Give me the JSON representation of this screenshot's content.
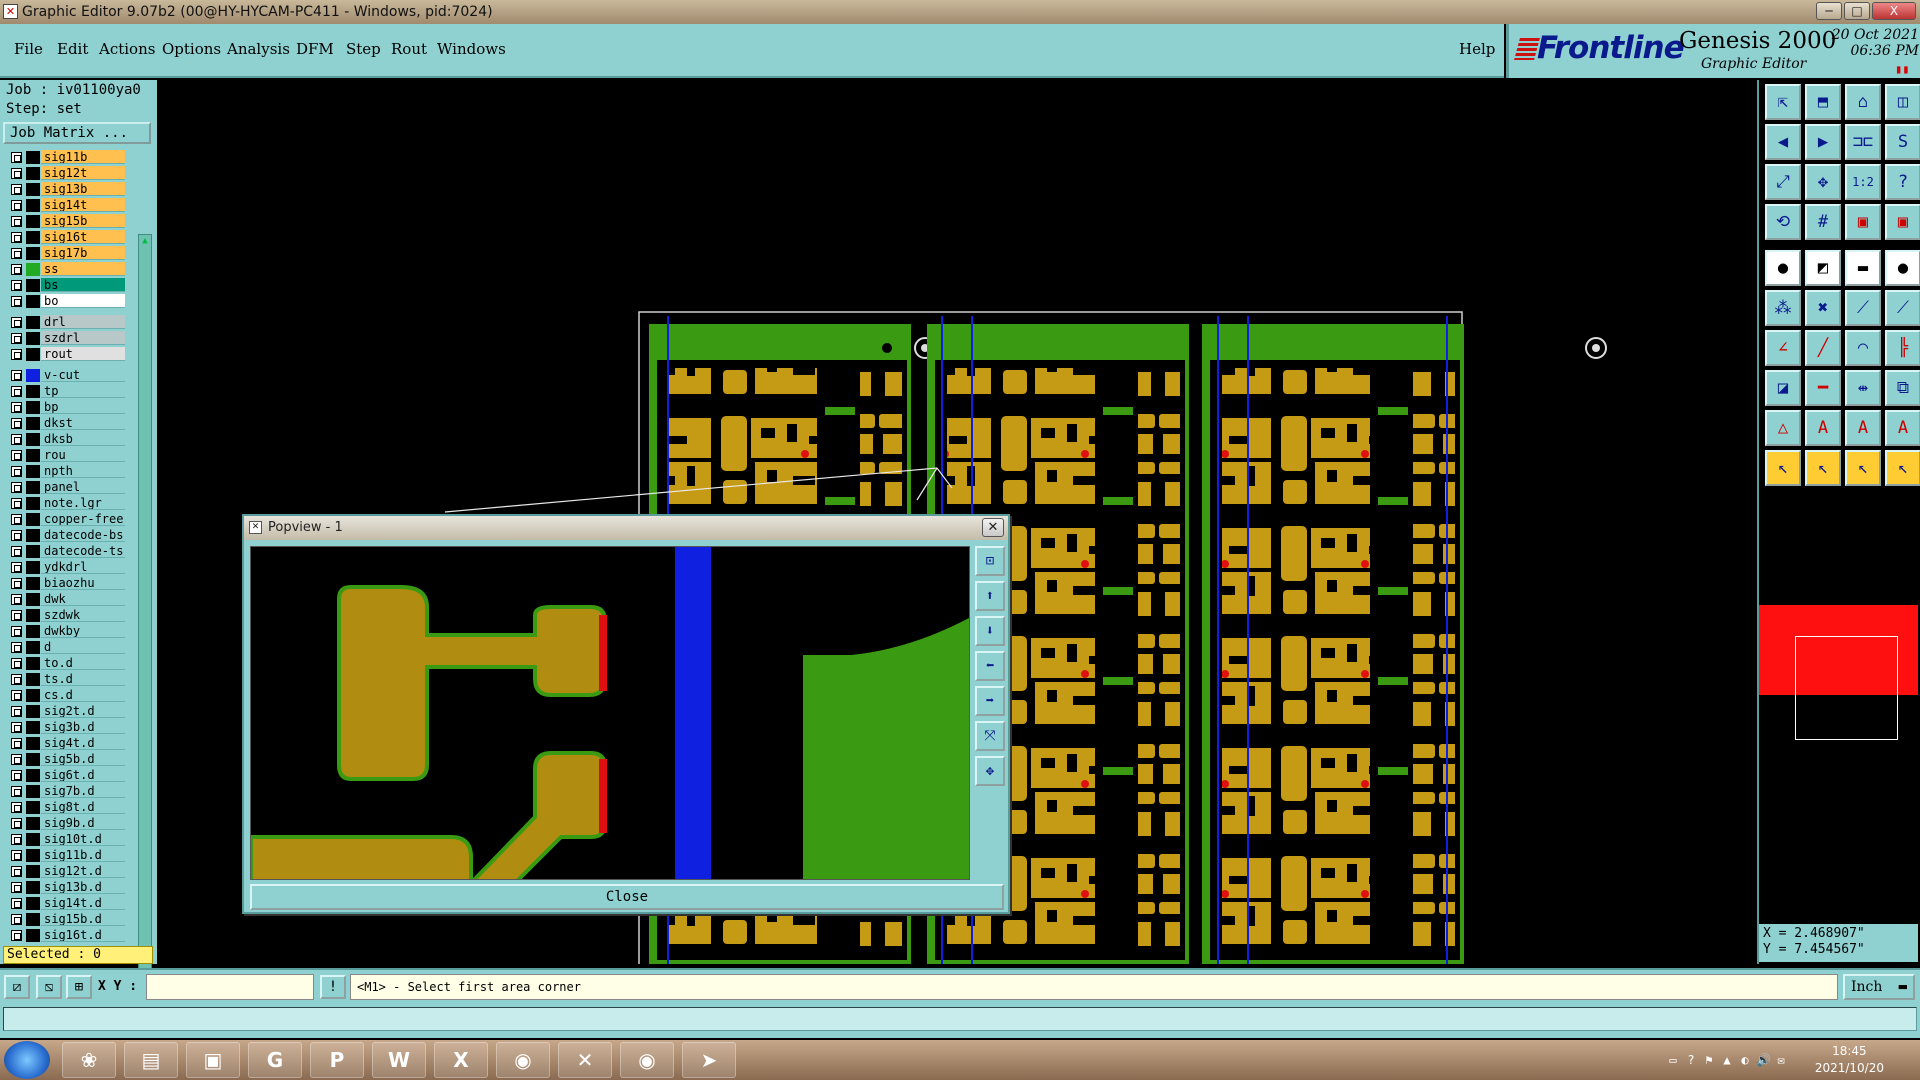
{
  "window": {
    "title": "Graphic Editor 9.07b2 (00@HY-HYCAM-PC411 - Windows, pid:7024)",
    "icon_name": "editor-app-icon",
    "minimize_glyph": "─",
    "maximize_glyph": "□",
    "close_glyph": "X"
  },
  "menubar": {
    "items": [
      "File",
      "Edit",
      "Actions",
      "Options",
      "Analysis",
      "DFM",
      "Step",
      "Rout",
      "Windows"
    ],
    "help": "Help"
  },
  "brand": {
    "logo": "Frontline",
    "product": "Genesis 2000",
    "subtitle": "Graphic Editor",
    "date": "20 Oct 2021",
    "time": "06:36 PM",
    "pause_glyph": "▮▮",
    "logo_color": "#0a1a8c",
    "accent_color": "#cc1111"
  },
  "leftpanel": {
    "job": "Job : iv01100ya0",
    "step": "Step: set",
    "job_matrix": "Job Matrix ...",
    "selected": "Selected : 0",
    "layers": [
      {
        "name": "sig11b",
        "color": "#ffc050",
        "swatch": "#000"
      },
      {
        "name": "sig12t",
        "color": "#ffc050",
        "swatch": "#000"
      },
      {
        "name": "sig13b",
        "color": "#ffc050",
        "swatch": "#000"
      },
      {
        "name": "sig14t",
        "color": "#ffc050",
        "swatch": "#000"
      },
      {
        "name": "sig15b",
        "color": "#ffc050",
        "swatch": "#000"
      },
      {
        "name": "sig16t",
        "color": "#ffc050",
        "swatch": "#000"
      },
      {
        "name": "sig17b",
        "color": "#ffc050",
        "swatch": "#000"
      },
      {
        "name": "ss",
        "color": "#ffc050",
        "swatch": "#22aa22"
      },
      {
        "name": "bs",
        "color": "#009a7a",
        "swatch": "#000"
      },
      {
        "name": "bo",
        "color": "#ffffff",
        "swatch": "#000"
      },
      {
        "name": "drl",
        "color": "#b8c8c8",
        "swatch": "#000",
        "gap": true
      },
      {
        "name": "szdrl",
        "color": "#b8c8c8",
        "swatch": "#000"
      },
      {
        "name": "rout",
        "color": "#e0e0e0",
        "swatch": "#000"
      },
      {
        "name": "v-cut",
        "color": "#8fd1d1",
        "swatch": "#1020e0",
        "gap": true
      },
      {
        "name": "tp",
        "color": "#8fd1d1",
        "swatch": "#000"
      },
      {
        "name": "bp",
        "color": "#8fd1d1",
        "swatch": "#000"
      },
      {
        "name": "dkst",
        "color": "#8fd1d1",
        "swatch": "#000"
      },
      {
        "name": "dksb",
        "color": "#8fd1d1",
        "swatch": "#000"
      },
      {
        "name": "rou",
        "color": "#8fd1d1",
        "swatch": "#000"
      },
      {
        "name": "npth",
        "color": "#8fd1d1",
        "swatch": "#000"
      },
      {
        "name": "panel",
        "color": "#8fd1d1",
        "swatch": "#000"
      },
      {
        "name": "note.lgr",
        "color": "#8fd1d1",
        "swatch": "#000"
      },
      {
        "name": "copper-free",
        "color": "#8fd1d1",
        "swatch": "#000"
      },
      {
        "name": "datecode-bs",
        "color": "#8fd1d1",
        "swatch": "#000"
      },
      {
        "name": "datecode-ts",
        "color": "#8fd1d1",
        "swatch": "#000"
      },
      {
        "name": "ydkdrl",
        "color": "#8fd1d1",
        "swatch": "#000"
      },
      {
        "name": "biaozhu",
        "color": "#8fd1d1",
        "swatch": "#000"
      },
      {
        "name": "dwk",
        "color": "#8fd1d1",
        "swatch": "#000"
      },
      {
        "name": "szdwk",
        "color": "#8fd1d1",
        "swatch": "#000"
      },
      {
        "name": "dwkby",
        "color": "#8fd1d1",
        "swatch": "#000"
      },
      {
        "name": "d",
        "color": "#8fd1d1",
        "swatch": "#000"
      },
      {
        "name": "to.d",
        "color": "#8fd1d1",
        "swatch": "#000"
      },
      {
        "name": "ts.d",
        "color": "#8fd1d1",
        "swatch": "#000"
      },
      {
        "name": "cs.d",
        "color": "#8fd1d1",
        "swatch": "#000"
      },
      {
        "name": "sig2t.d",
        "color": "#8fd1d1",
        "swatch": "#000"
      },
      {
        "name": "sig3b.d",
        "color": "#8fd1d1",
        "swatch": "#000"
      },
      {
        "name": "sig4t.d",
        "color": "#8fd1d1",
        "swatch": "#000"
      },
      {
        "name": "sig5b.d",
        "color": "#8fd1d1",
        "swatch": "#000"
      },
      {
        "name": "sig6t.d",
        "color": "#8fd1d1",
        "swatch": "#000"
      },
      {
        "name": "sig7b.d",
        "color": "#8fd1d1",
        "swatch": "#000"
      },
      {
        "name": "sig8t.d",
        "color": "#8fd1d1",
        "swatch": "#000"
      },
      {
        "name": "sig9b.d",
        "color": "#8fd1d1",
        "swatch": "#000"
      },
      {
        "name": "sig10t.d",
        "color": "#8fd1d1",
        "swatch": "#000"
      },
      {
        "name": "sig11b.d",
        "color": "#8fd1d1",
        "swatch": "#000"
      },
      {
        "name": "sig12t.d",
        "color": "#8fd1d1",
        "swatch": "#000"
      },
      {
        "name": "sig13b.d",
        "color": "#8fd1d1",
        "swatch": "#000"
      },
      {
        "name": "sig14t.d",
        "color": "#8fd1d1",
        "swatch": "#000"
      },
      {
        "name": "sig15b.d",
        "color": "#8fd1d1",
        "swatch": "#000"
      },
      {
        "name": "sig16t.d",
        "color": "#8fd1d1",
        "swatch": "#000"
      }
    ]
  },
  "popview": {
    "title": "Popview - 1",
    "close_button": "Close",
    "close_glyph": "✕",
    "tools": [
      "popview-zoom-home-icon",
      "popview-pan-up-icon",
      "popview-pan-down-icon",
      "popview-pan-left-icon",
      "popview-pan-right-icon",
      "popview-zoom-fit-icon",
      "popview-zoom-center-icon"
    ],
    "tool_glyphs": [
      "⊡",
      "⬆",
      "⬇",
      "⬅",
      "➡",
      "⤧",
      "✥"
    ]
  },
  "right_toolbar": {
    "buttons": [
      {
        "name": "zoom-home-icon",
        "glyph": "⇱",
        "style": ""
      },
      {
        "name": "zoom-screen-icon",
        "glyph": "⬒",
        "style": ""
      },
      {
        "name": "home-icon",
        "glyph": "⌂",
        "style": ""
      },
      {
        "name": "window-split-icon",
        "glyph": "◫",
        "style": ""
      },
      {
        "name": "pan-left-icon",
        "glyph": "◀",
        "style": ""
      },
      {
        "name": "pan-right-icon",
        "glyph": "▶",
        "style": ""
      },
      {
        "name": "mirror-icon",
        "glyph": "⊐⊏",
        "style": ""
      },
      {
        "name": "snap-icon",
        "glyph": "S",
        "style": ""
      },
      {
        "name": "zoom-fit-icon",
        "glyph": "⤢",
        "style": ""
      },
      {
        "name": "zoom-center-icon",
        "glyph": "✥",
        "style": ""
      },
      {
        "name": "scale-ratio-icon",
        "glyph": "1:2",
        "style": ""
      },
      {
        "name": "help-icon",
        "glyph": "?",
        "style": ""
      },
      {
        "name": "rotate-view-icon",
        "glyph": "⟲",
        "style": ""
      },
      {
        "name": "grid-icon",
        "glyph": "#",
        "style": ""
      },
      {
        "name": "measure-red-icon",
        "glyph": "▣",
        "style": "redish"
      },
      {
        "name": "measure-alt-icon",
        "glyph": "▣",
        "style": "redish"
      },
      {
        "name": "pad-icon",
        "glyph": "●",
        "style": "white"
      },
      {
        "name": "line-color-icon",
        "glyph": "◩",
        "style": "white"
      },
      {
        "name": "ruler-icon",
        "glyph": "▬",
        "style": "white"
      },
      {
        "name": "dot-icon",
        "glyph": "●",
        "style": "white"
      },
      {
        "name": "add-pad-icon",
        "glyph": "⁂",
        "style": ""
      },
      {
        "name": "delete-icon",
        "glyph": "✖",
        "style": ""
      },
      {
        "name": "line-node-icon",
        "glyph": "⟋",
        "style": ""
      },
      {
        "name": "line-node-alt-icon",
        "glyph": "⟋",
        "style": ""
      },
      {
        "name": "angle-icon",
        "glyph": "∠",
        "style": "redish"
      },
      {
        "name": "slope-icon",
        "glyph": "╱",
        "style": "redish"
      },
      {
        "name": "arc-icon",
        "glyph": "◠",
        "style": ""
      },
      {
        "name": "align-icon",
        "glyph": "╠",
        "style": "redish"
      },
      {
        "name": "shape-node-icon",
        "glyph": "◪",
        "style": ""
      },
      {
        "name": "horizontal-line-icon",
        "glyph": "━",
        "style": "redish"
      },
      {
        "name": "spacing-icon",
        "glyph": "⇹",
        "style": ""
      },
      {
        "name": "copy-icon",
        "glyph": "⧉",
        "style": ""
      },
      {
        "name": "triangle-icon",
        "glyph": "△",
        "style": "redish"
      },
      {
        "name": "text-a-icon",
        "glyph": "A",
        "style": "redish"
      },
      {
        "name": "text-a-alt-icon",
        "glyph": "A",
        "style": "redish"
      },
      {
        "name": "text-a-fill-icon",
        "glyph": "A",
        "style": "redish"
      },
      {
        "name": "pointer-icon",
        "glyph": "↖",
        "style": "yellow"
      },
      {
        "name": "pointer-select-icon",
        "glyph": "↖",
        "style": "yellow"
      },
      {
        "name": "pointer-box-icon",
        "glyph": "↖",
        "style": "yellow"
      },
      {
        "name": "pointer-multi-icon",
        "glyph": "↖",
        "style": "yellow"
      }
    ]
  },
  "coords": {
    "x": "X = 2.468907\"",
    "y": "Y = 7.454567\""
  },
  "bottombar": {
    "xy_label": "X Y :",
    "xy_value": "",
    "prompt": "<M1> - Select first area corner",
    "unit": "Inch",
    "icons": [
      "snap-mode-icon",
      "measure-mode-icon",
      "grid-mode-icon",
      "message-icon"
    ],
    "icon_glyphs": [
      "⧄",
      "⧅",
      "⊞",
      "!"
    ]
  },
  "taskbar": {
    "apps": [
      "explorer-folder-icon",
      "notepad-icon",
      "save-floppy-icon",
      "g-app-icon",
      "p-app-icon",
      "word-icon",
      "excel-icon",
      "eye-app-icon",
      "x-app-icon",
      "camera-app-icon",
      "send-app-icon"
    ],
    "app_glyphs": [
      "❀",
      "▤",
      "▣",
      "G",
      "P",
      "W",
      "X",
      "◉",
      "✕",
      "◉",
      "➤"
    ],
    "time": "18:45",
    "date": "2021/10/20",
    "tray_glyphs": [
      "▭",
      "?",
      "⚑",
      "▲",
      "◐",
      "🔊",
      "✉"
    ]
  },
  "colors": {
    "ui_teal": "#8fd1d1",
    "copper": "#c59a14",
    "board_green": "#3a9a12",
    "vcut_blue": "#1020e0",
    "pad_red": "#e01010"
  }
}
